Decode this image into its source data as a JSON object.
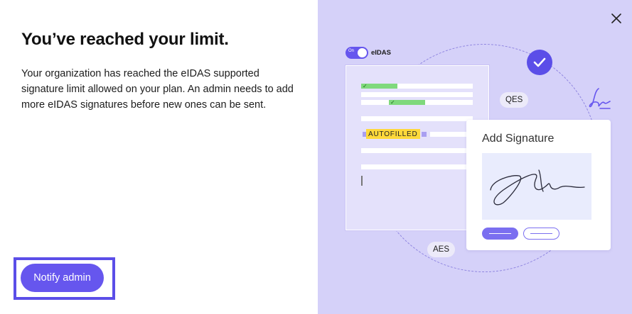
{
  "dialog": {
    "title": "You’ve reached your limit.",
    "body": "Your organization has reached the eIDAS supported signature limit allowed on your plan. An admin needs to add more eIDAS signatures before new ones can be sent.",
    "notify_button": "Notify admin",
    "close_icon": "close-icon"
  },
  "illustration": {
    "toggle_state": "On",
    "toggle_label": "eIDAS",
    "autofilled_tag": "AUTOFILLED",
    "qes_label": "QES",
    "aes_label": "AES",
    "card_title": "Add Signature",
    "check_icon": "check-circle-icon",
    "signature_icon": "signature-icon"
  },
  "colors": {
    "accent": "#6656ee",
    "illustration_bg": "#d5d1f9",
    "highlight_green": "#7fd97c",
    "highlight_yellow": "#ffd93a"
  }
}
